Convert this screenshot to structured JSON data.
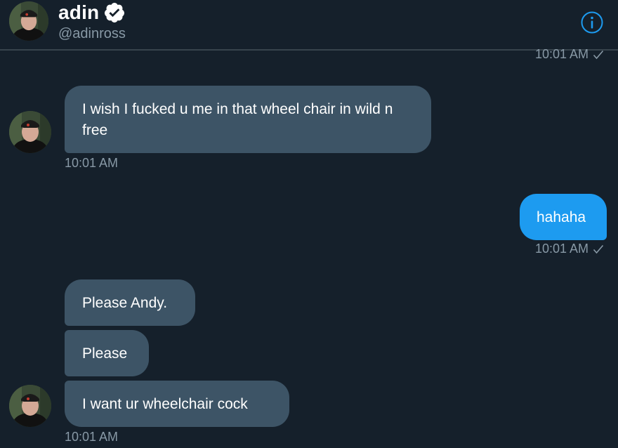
{
  "header": {
    "display_name": "adin",
    "handle": "@adinross",
    "verified_icon": "verified-badge-icon",
    "info_icon": "info-icon"
  },
  "conversation": {
    "top_timestamp": "10:01 AM",
    "messages": [
      {
        "direction": "incoming",
        "text": "I wish I fucked u me in that wheel chair in wild n free",
        "timestamp": "10:01 AM"
      },
      {
        "direction": "outgoing",
        "text": "hahaha",
        "timestamp": "10:01 AM"
      },
      {
        "direction": "incoming",
        "text": "Please Andy."
      },
      {
        "direction": "incoming",
        "text": "Please"
      },
      {
        "direction": "incoming",
        "text": "I want ur wheelchair cock",
        "timestamp": "10:01 AM"
      }
    ]
  },
  "colors": {
    "background": "#15202b",
    "incoming_bubble": "#3d5466",
    "outgoing_bubble": "#1d9bf0",
    "secondary_text": "#8899a6",
    "accent": "#1d9bf0"
  }
}
